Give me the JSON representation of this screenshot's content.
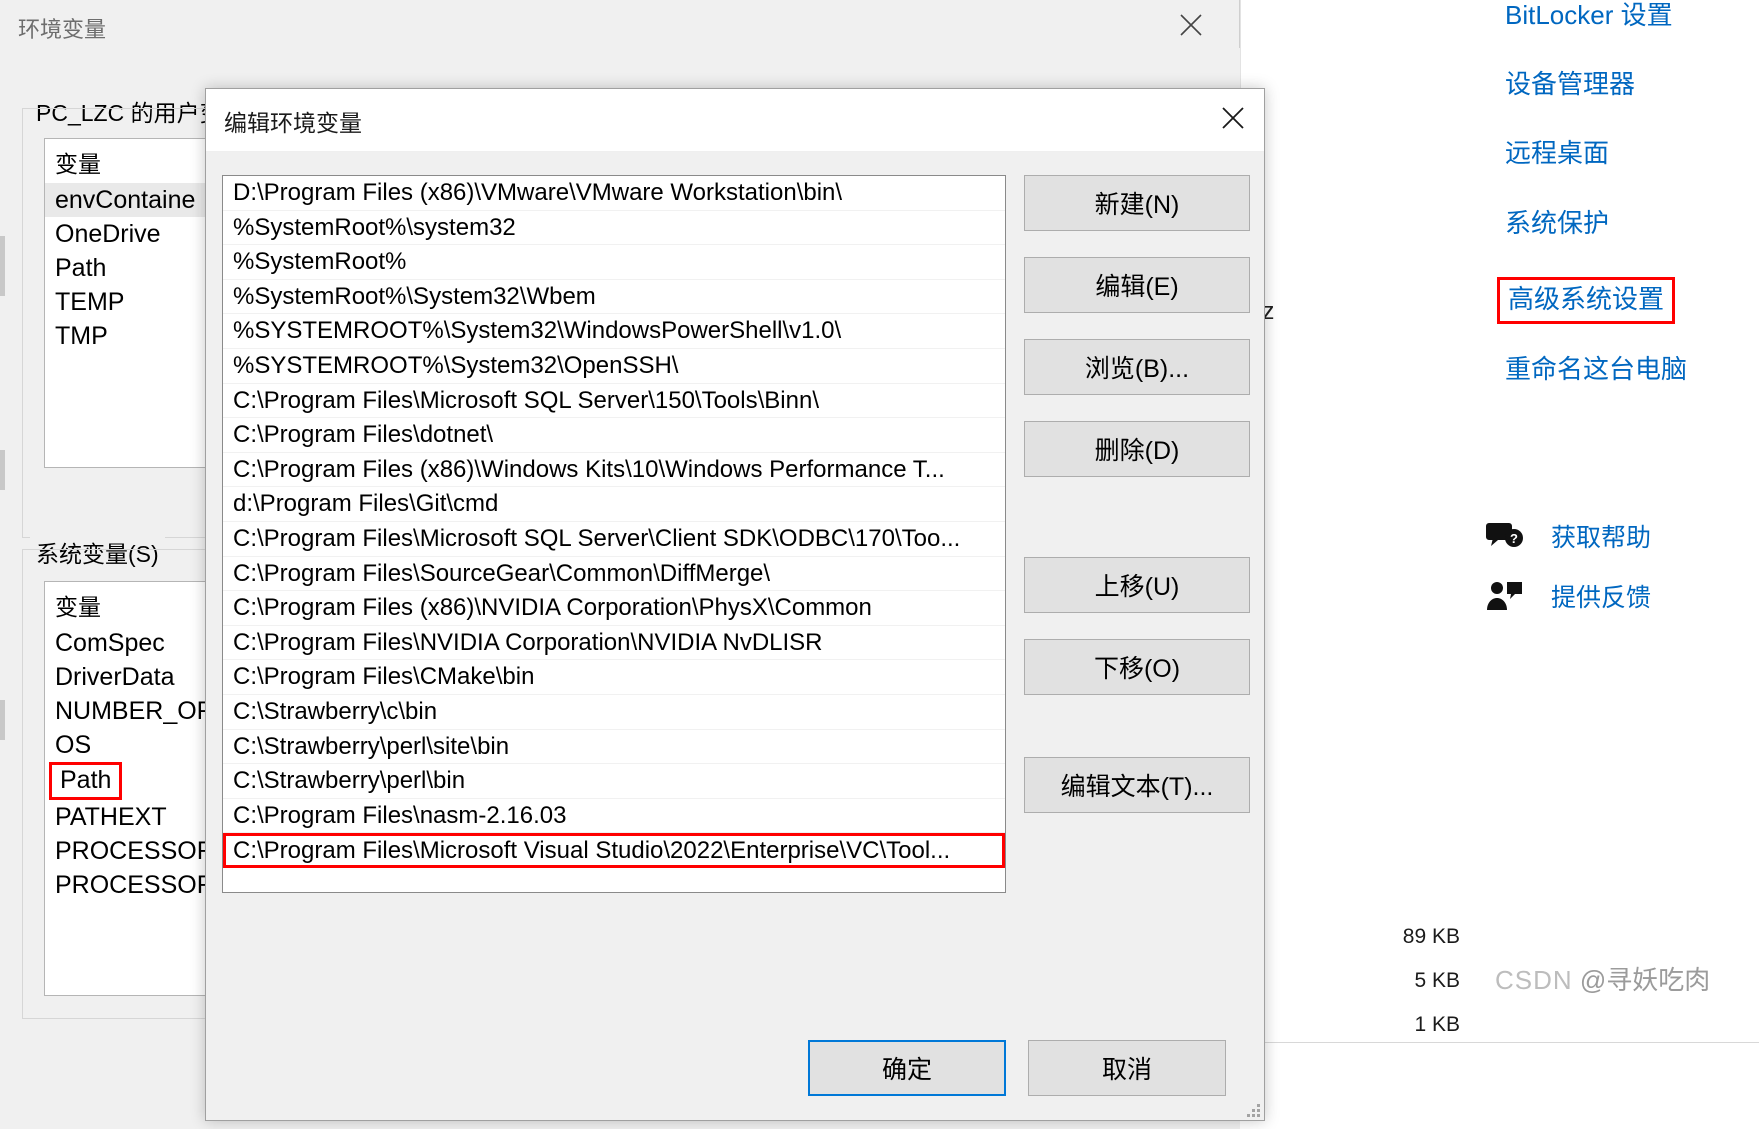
{
  "env_window": {
    "title": "环境变量",
    "close_label": "✕",
    "user_vars_label": "PC_LZC 的用户变量(U)",
    "user_vars_header": "变量",
    "user_vars": [
      {
        "name": "envContaine",
        "selected": true
      },
      {
        "name": "OneDrive",
        "selected": false
      },
      {
        "name": "Path",
        "selected": false
      },
      {
        "name": "TEMP",
        "selected": false
      },
      {
        "name": "TMP",
        "selected": false
      }
    ],
    "system_vars_label": "系统变量(S)",
    "system_vars_header": "变量",
    "system_vars": [
      {
        "name": "ComSpec",
        "selected": false,
        "redbox": false
      },
      {
        "name": "DriverData",
        "selected": false,
        "redbox": false
      },
      {
        "name": "NUMBER_OF",
        "selected": false,
        "redbox": false
      },
      {
        "name": "OS",
        "selected": false,
        "redbox": false
      },
      {
        "name": "Path",
        "selected": true,
        "redbox": true
      },
      {
        "name": "PATHEXT",
        "selected": false,
        "redbox": false
      },
      {
        "name": "PROCESSOR",
        "selected": false,
        "redbox": false
      },
      {
        "name": "PROCESSOR",
        "selected": false,
        "redbox": false
      }
    ]
  },
  "dialog": {
    "title": "编辑环境变量",
    "close_label": "✕",
    "paths": [
      {
        "value": "D:\\Program Files (x86)\\VMware\\VMware Workstation\\bin\\",
        "highlighted": false
      },
      {
        "value": "%SystemRoot%\\system32",
        "highlighted": false
      },
      {
        "value": "%SystemRoot%",
        "highlighted": false
      },
      {
        "value": "%SystemRoot%\\System32\\Wbem",
        "highlighted": false
      },
      {
        "value": "%SYSTEMROOT%\\System32\\WindowsPowerShell\\v1.0\\",
        "highlighted": false
      },
      {
        "value": "%SYSTEMROOT%\\System32\\OpenSSH\\",
        "highlighted": false
      },
      {
        "value": "C:\\Program Files\\Microsoft SQL Server\\150\\Tools\\Binn\\",
        "highlighted": false
      },
      {
        "value": "C:\\Program Files\\dotnet\\",
        "highlighted": false
      },
      {
        "value": "C:\\Program Files (x86)\\Windows Kits\\10\\Windows Performance T...",
        "highlighted": false
      },
      {
        "value": "d:\\Program Files\\Git\\cmd",
        "highlighted": false
      },
      {
        "value": "C:\\Program Files\\Microsoft SQL Server\\Client SDK\\ODBC\\170\\Too...",
        "highlighted": false
      },
      {
        "value": "C:\\Program Files\\SourceGear\\Common\\DiffMerge\\",
        "highlighted": false
      },
      {
        "value": "C:\\Program Files (x86)\\NVIDIA Corporation\\PhysX\\Common",
        "highlighted": false
      },
      {
        "value": "C:\\Program Files\\NVIDIA Corporation\\NVIDIA NvDLISR",
        "highlighted": false
      },
      {
        "value": "C:\\Program Files\\CMake\\bin",
        "highlighted": false
      },
      {
        "value": "C:\\Strawberry\\c\\bin",
        "highlighted": false
      },
      {
        "value": "C:\\Strawberry\\perl\\site\\bin",
        "highlighted": false
      },
      {
        "value": "C:\\Strawberry\\perl\\bin",
        "highlighted": false
      },
      {
        "value": "C:\\Program Files\\nasm-2.16.03",
        "highlighted": false
      },
      {
        "value": "C:\\Program Files\\Microsoft Visual Studio\\2022\\Enterprise\\VC\\Tool...",
        "highlighted": true
      }
    ],
    "buttons": {
      "new": "新建(N)",
      "edit": "编辑(E)",
      "browse": "浏览(B)...",
      "delete": "删除(D)",
      "move_up": "上移(U)",
      "move_down": "下移(O)",
      "edit_text": "编辑文本(T)..."
    },
    "footer": {
      "ok": "确定",
      "cancel": "取消"
    }
  },
  "settings_page": {
    "links": [
      {
        "label": "BitLocker 设置",
        "highlighted": false
      },
      {
        "label": "设备管理器",
        "highlighted": false
      },
      {
        "label": "远程桌面",
        "highlighted": false
      },
      {
        "label": "系统保护",
        "highlighted": false
      },
      {
        "label": "高级系统设置",
        "highlighted": true
      },
      {
        "label": "重命名这台电脑",
        "highlighted": false
      }
    ],
    "help_items": [
      {
        "label": "获取帮助",
        "icon": "help-balloon-icon"
      },
      {
        "label": "提供反馈",
        "icon": "feedback-person-icon"
      }
    ],
    "stray_text": "Hz",
    "file_sizes": [
      "89 KB",
      "5 KB",
      "1 KB"
    ],
    "watermark_prefix": "CSDN",
    "watermark_author": "@寻妖吃肉"
  },
  "colors": {
    "link": "#0067c0",
    "highlight_red": "#ff0000",
    "dialog_bg": "#f0f0f0",
    "button_bg": "#e1e1e1",
    "accent_blue": "#0078d7"
  }
}
